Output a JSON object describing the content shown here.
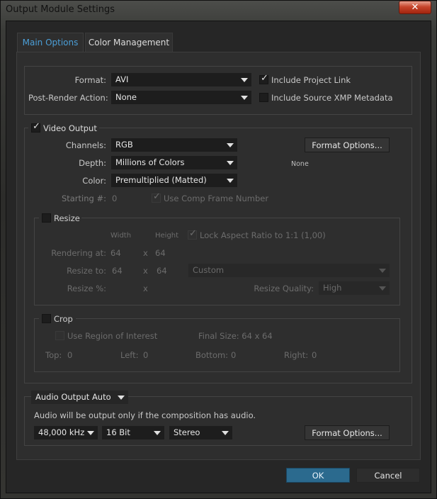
{
  "window": {
    "title": "Output Module Settings",
    "close_glyph": "✕"
  },
  "tabs": [
    {
      "label": "Main Options",
      "active": true
    },
    {
      "label": "Color Management",
      "active": false
    }
  ],
  "top": {
    "format_label": "Format:",
    "format_value": "AVI",
    "post_render_label": "Post-Render Action:",
    "post_render_value": "None",
    "include_project_link": {
      "label": "Include Project Link",
      "checked": true
    },
    "include_xmp": {
      "label": "Include Source XMP Metadata",
      "checked": false
    }
  },
  "video": {
    "label": "Video Output",
    "checked": true,
    "channels_label": "Channels:",
    "channels_value": "RGB",
    "depth_label": "Depth:",
    "depth_value": "Millions of Colors",
    "color_label": "Color:",
    "color_value": "Premultiplied (Matted)",
    "starting_label": "Starting #:",
    "starting_value": "0",
    "use_comp_frame": {
      "label": "Use Comp Frame Number",
      "checked": true
    },
    "format_options_button": "Format Options...",
    "codec_text": "None"
  },
  "resize": {
    "label": "Resize",
    "checked": false,
    "width_header": "Width",
    "height_header": "Height",
    "lock_aspect": {
      "label": "Lock Aspect Ratio to 1:1 (1,00)",
      "checked": true
    },
    "rendering_at_label": "Rendering at:",
    "rendering_w": "64",
    "rendering_h": "64",
    "resize_to_label": "Resize to:",
    "resize_to_w": "64",
    "resize_to_h": "64",
    "resize_preset": "Custom",
    "resize_pct_label": "Resize %:",
    "x_glyph": "x",
    "quality_label": "Resize Quality:",
    "quality_value": "High"
  },
  "crop": {
    "label": "Crop",
    "checked": false,
    "use_roi": {
      "label": "Use Region of Interest",
      "checked": false
    },
    "final_size": "Final Size: 64 x 64",
    "top_label": "Top:",
    "top_value": "0",
    "left_label": "Left:",
    "left_value": "0",
    "bottom_label": "Bottom:",
    "bottom_value": "0",
    "right_label": "Right:",
    "right_value": "0"
  },
  "audio": {
    "output_menu": "Audio Output Auto",
    "note": "Audio will be output only if the composition has audio.",
    "rate": "48,000 kHz",
    "bits": "16 Bit",
    "channels": "Stereo",
    "format_options_button": "Format Options..."
  },
  "footer": {
    "ok": "OK",
    "cancel": "Cancel"
  },
  "colors": {
    "accent": "#4b9fd8",
    "ok_button": "#2b6a8e",
    "close_button": "#c6442b"
  }
}
